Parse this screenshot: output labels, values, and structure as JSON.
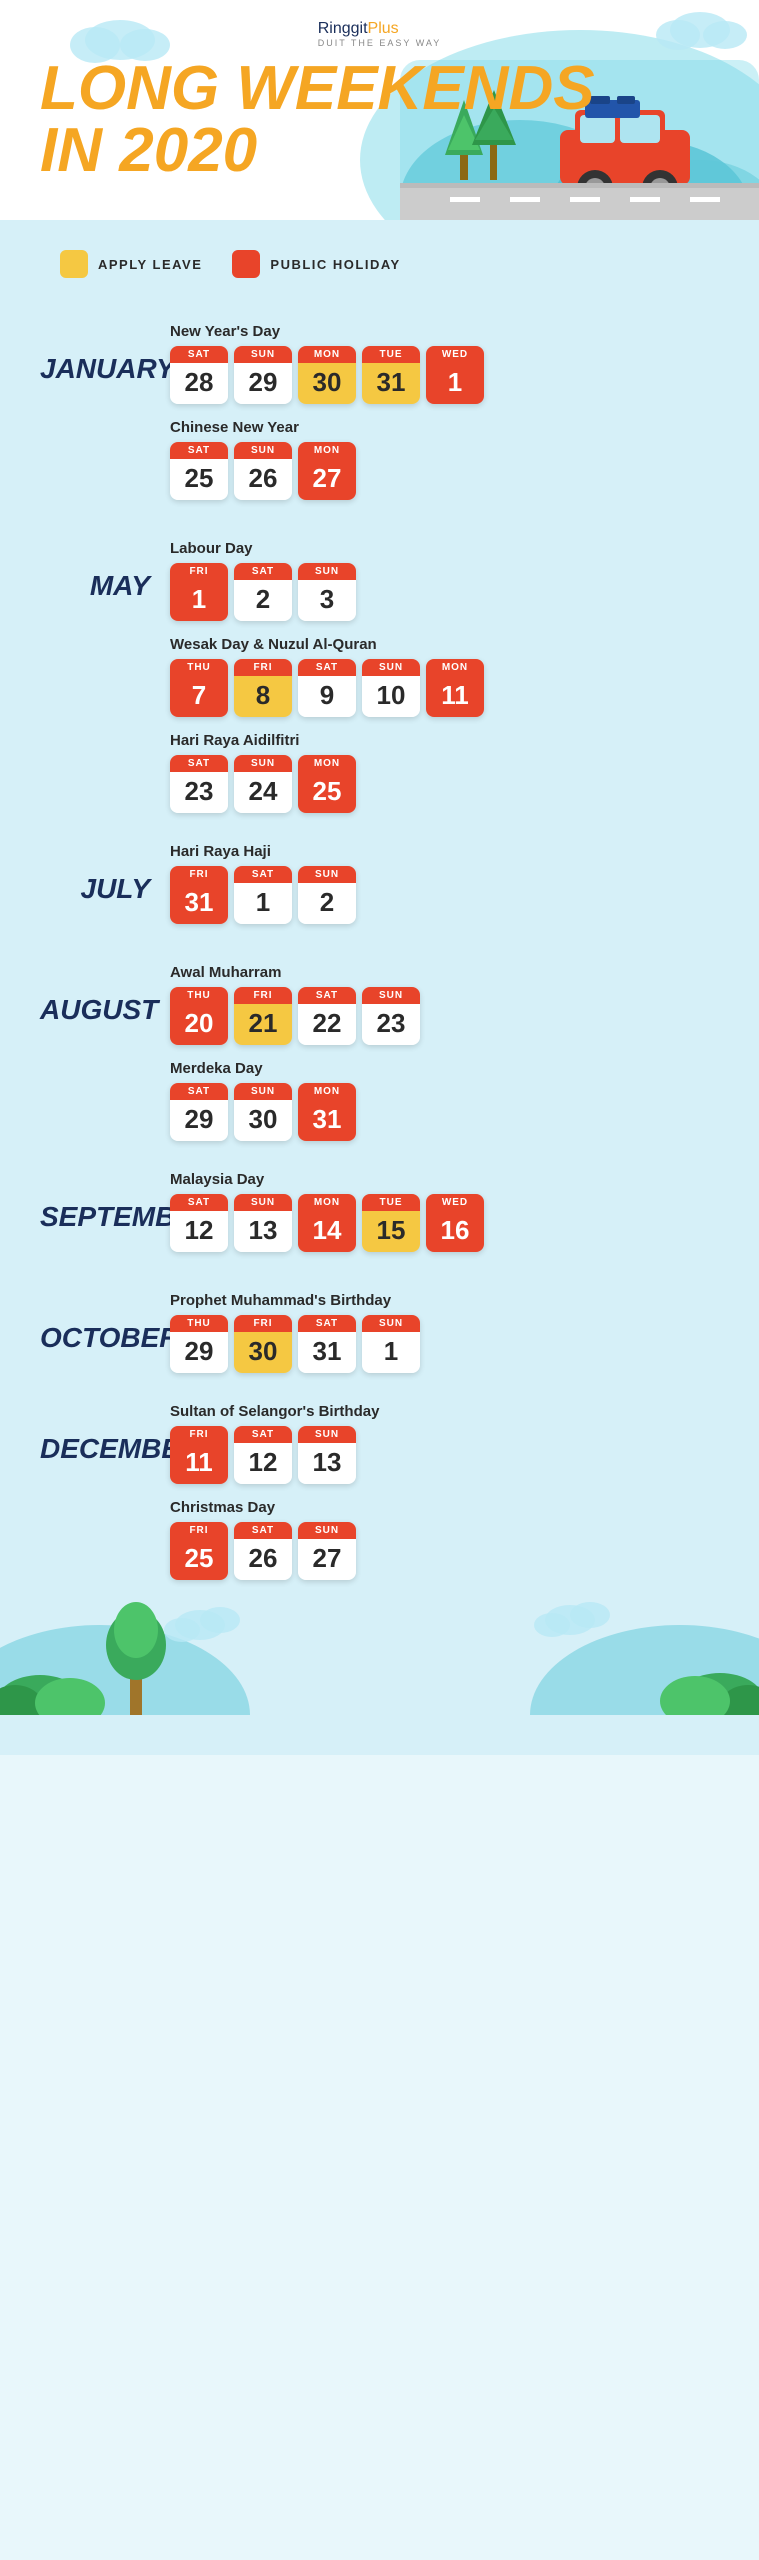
{
  "app": {
    "logo": {
      "ringgit": "Ringgit",
      "plus": "Plus",
      "tagline": "DUIT THE EASY WAY"
    },
    "title_line1": "Long Weekends",
    "title_line2": "in 2020"
  },
  "legend": {
    "apply_leave": "Apply Leave",
    "public_holiday": "Public Holiday"
  },
  "months": [
    {
      "name": "January",
      "events": [
        {
          "name": "New Year's Day",
          "days": [
            {
              "day": "SAT",
              "num": "28",
              "type": "white"
            },
            {
              "day": "SUN",
              "num": "29",
              "type": "white"
            },
            {
              "day": "MON",
              "num": "30",
              "type": "yellow"
            },
            {
              "day": "TUE",
              "num": "31",
              "type": "yellow"
            },
            {
              "day": "WED",
              "num": "1",
              "type": "orange"
            }
          ]
        },
        {
          "name": "Chinese New Year",
          "days": [
            {
              "day": "SAT",
              "num": "25",
              "type": "white"
            },
            {
              "day": "SUN",
              "num": "26",
              "type": "white"
            },
            {
              "day": "MON",
              "num": "27",
              "type": "orange"
            }
          ]
        }
      ]
    },
    {
      "name": "May",
      "events": [
        {
          "name": "Labour Day",
          "days": [
            {
              "day": "FRI",
              "num": "1",
              "type": "orange"
            },
            {
              "day": "SAT",
              "num": "2",
              "type": "white"
            },
            {
              "day": "SUN",
              "num": "3",
              "type": "white"
            }
          ]
        },
        {
          "name": "Wesak Day & Nuzul Al-Quran",
          "days": [
            {
              "day": "THU",
              "num": "7",
              "type": "orange"
            },
            {
              "day": "FRI",
              "num": "8",
              "type": "yellow"
            },
            {
              "day": "SAT",
              "num": "9",
              "type": "white"
            },
            {
              "day": "SUN",
              "num": "10",
              "type": "white"
            },
            {
              "day": "MON",
              "num": "11",
              "type": "orange"
            }
          ]
        },
        {
          "name": "Hari Raya Aidilfitri",
          "days": [
            {
              "day": "SAT",
              "num": "23",
              "type": "white"
            },
            {
              "day": "SUN",
              "num": "24",
              "type": "white"
            },
            {
              "day": "MON",
              "num": "25",
              "type": "orange"
            }
          ]
        }
      ]
    },
    {
      "name": "July",
      "events": [
        {
          "name": "Hari Raya Haji",
          "days": [
            {
              "day": "FRI",
              "num": "31",
              "type": "orange"
            },
            {
              "day": "SAT",
              "num": "1",
              "type": "white"
            },
            {
              "day": "SUN",
              "num": "2",
              "type": "white"
            }
          ]
        }
      ]
    },
    {
      "name": "August",
      "events": [
        {
          "name": "Awal Muharram",
          "days": [
            {
              "day": "THU",
              "num": "20",
              "type": "orange"
            },
            {
              "day": "FRI",
              "num": "21",
              "type": "yellow"
            },
            {
              "day": "SAT",
              "num": "22",
              "type": "white"
            },
            {
              "day": "SUN",
              "num": "23",
              "type": "white"
            }
          ]
        },
        {
          "name": "Merdeka Day",
          "days": [
            {
              "day": "SAT",
              "num": "29",
              "type": "white"
            },
            {
              "day": "SUN",
              "num": "30",
              "type": "white"
            },
            {
              "day": "MON",
              "num": "31",
              "type": "orange"
            }
          ]
        }
      ]
    },
    {
      "name": "September",
      "events": [
        {
          "name": "Malaysia Day",
          "days": [
            {
              "day": "SAT",
              "num": "12",
              "type": "white"
            },
            {
              "day": "SUN",
              "num": "13",
              "type": "white"
            },
            {
              "day": "MON",
              "num": "14",
              "type": "orange"
            },
            {
              "day": "TUE",
              "num": "15",
              "type": "yellow"
            },
            {
              "day": "Wed",
              "num": "16",
              "type": "orange"
            }
          ]
        }
      ]
    },
    {
      "name": "October",
      "events": [
        {
          "name": "Prophet Muhammad's Birthday",
          "days": [
            {
              "day": "THU",
              "num": "29",
              "type": "white"
            },
            {
              "day": "FRI",
              "num": "30",
              "type": "yellow"
            },
            {
              "day": "SAT",
              "num": "31",
              "type": "white"
            },
            {
              "day": "SUN",
              "num": "1",
              "type": "white"
            }
          ]
        }
      ]
    },
    {
      "name": "December",
      "events": [
        {
          "name": "Sultan of Selangor's Birthday",
          "days": [
            {
              "day": "FRI",
              "num": "11",
              "type": "orange"
            },
            {
              "day": "SAT",
              "num": "12",
              "type": "white"
            },
            {
              "day": "SUN",
              "num": "13",
              "type": "white"
            }
          ]
        },
        {
          "name": "Christmas Day",
          "days": [
            {
              "day": "FRI",
              "num": "25",
              "type": "orange"
            },
            {
              "day": "SAT",
              "num": "26",
              "type": "white"
            },
            {
              "day": "SUN",
              "num": "27",
              "type": "white"
            }
          ]
        }
      ]
    }
  ]
}
